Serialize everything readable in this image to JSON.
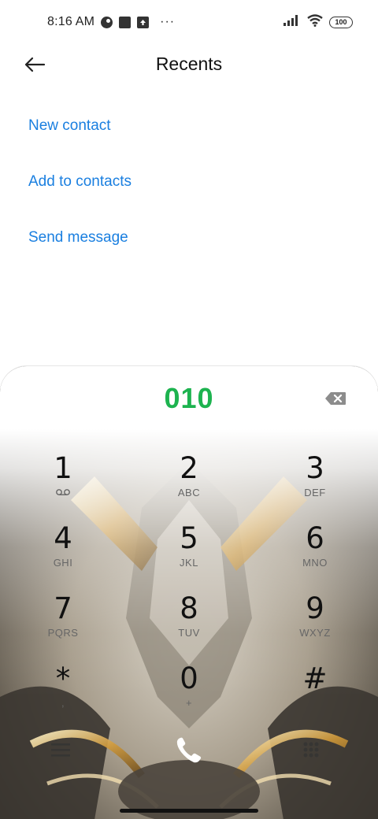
{
  "status_bar": {
    "time": "8:16 AM",
    "dots": "···",
    "battery": "100"
  },
  "header": {
    "title": "Recents",
    "back_icon": "arrow-left-icon"
  },
  "actions": [
    {
      "label": "New contact"
    },
    {
      "label": "Add to contacts"
    },
    {
      "label": "Send message"
    }
  ],
  "dialer": {
    "number": "010",
    "keys": [
      {
        "digit": "1",
        "sub": ""
      },
      {
        "digit": "2",
        "sub": "ABC"
      },
      {
        "digit": "3",
        "sub": "DEF"
      },
      {
        "digit": "4",
        "sub": "GHI"
      },
      {
        "digit": "5",
        "sub": "JKL"
      },
      {
        "digit": "6",
        "sub": "MNO"
      },
      {
        "digit": "7",
        "sub": "PQRS"
      },
      {
        "digit": "8",
        "sub": "TUV"
      },
      {
        "digit": "9",
        "sub": "WXYZ"
      },
      {
        "digit": "*",
        "sub": ","
      },
      {
        "digit": "0",
        "sub": "+"
      },
      {
        "digit": "#",
        "sub": ""
      }
    ]
  },
  "colors": {
    "accent_link": "#1a7fe0",
    "number_green": "#1db34f"
  }
}
